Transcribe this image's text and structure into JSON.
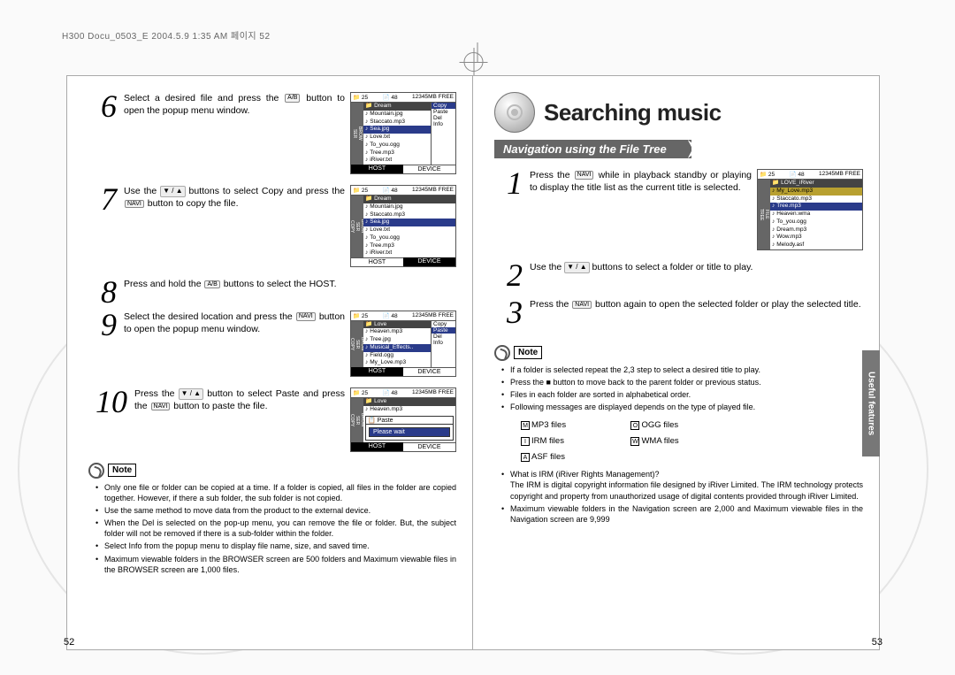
{
  "header": "H300 Docu_0503_E  2004.5.9 1:35 AM  페이지 52",
  "left_page": {
    "steps": [
      {
        "n": "6",
        "text_a": "Select a desired file and press the ",
        "btn": "A/B",
        "text_b": " button to open the popup menu window."
      },
      {
        "n": "7",
        "text_a": "Use the ",
        "arrows": "▼ / ▲",
        "text_b": " buttons to select Copy and press the ",
        "btn": "NAVI",
        "text_c": " button to copy the file."
      },
      {
        "n": "8",
        "text_a": "Press and hold the ",
        "btn": "A/B",
        "text_b": " buttons to select the HOST."
      },
      {
        "n": "9",
        "text_a": "Select the desired location and press the ",
        "btn": "NAVI",
        "text_b": " button to open the popup menu window."
      },
      {
        "n": "10",
        "text_a": "Press the ",
        "arrows": "▼ / ▲",
        "text_b": " button to select Paste and press the ",
        "btn": "NAVI",
        "text_c": " button to paste the file."
      }
    ],
    "shot_top": {
      "a": "📁 25",
      "b": "📄 48",
      "c": "12345MB FREE"
    },
    "shot1": {
      "header": "Dream",
      "rows": [
        "Mountain.jpg",
        "Staccato.mp3",
        "Sea.jpg",
        "Love.txt",
        "To_you.ogg",
        "Tree.mp3",
        "iRiver.txt"
      ],
      "sel_idx": 2,
      "menu": [
        "Copy",
        "Paste",
        "Del",
        "Info"
      ],
      "menu_sel": 0
    },
    "shot2": {
      "header": "Dream",
      "rows": [
        "Mountain.jpg",
        "Staccato.mp3",
        "Sea.jpg",
        "Love.txt",
        "To_you.ogg",
        "Tree.mp3",
        "iRiver.txt"
      ],
      "sel_idx": 2
    },
    "shot3": {
      "header": "Love",
      "rows": [
        "Heaven.mp3",
        "Tree.jpg",
        "Musical_Effects..",
        "Field.ogg",
        "My_Love.mp3"
      ],
      "sel_idx": 2,
      "menu": [
        "Copy",
        "Paste",
        "Del",
        "Info"
      ],
      "menu_sel": 1
    },
    "shot4": {
      "header": "Love",
      "rows": [
        "Heaven.mp3"
      ],
      "paste_t": "Paste",
      "paste_msg": "Please wait"
    },
    "note_label": "Note",
    "notes": [
      "Only one file or folder can be copied at a time. If a folder is copied, all files in the folder are copied together. However, if there a sub folder, the sub folder is not copied.",
      "Use the same method to move data from the product to the external device.",
      "When the Del is selected on the pop-up menu, you can remove the file or folder. But, the subject folder will not be removed if there is a sub-folder within the folder.",
      "Select Info from the popup menu to display file name, size, and saved time.",
      "Maximum viewable folders in the BROWSER screen are 500 folders and Maximum viewable files in the BROWSER screen are 1,000 files."
    ],
    "pageno": "52"
  },
  "right_page": {
    "title": "Searching music",
    "section": "Navigation using the File Tree",
    "side_tab": "Useful features",
    "steps": [
      {
        "n": "1",
        "text_a": "Press the ",
        "btn": "NAVI",
        "text_b": " while in playback standby or playing to display the title list as the current title is selected."
      },
      {
        "n": "2",
        "text_a": "Use the ",
        "arrows": "▼ / ▲",
        "text_b": " buttons to select a folder or title to play."
      },
      {
        "n": "3",
        "text_a": "Press the ",
        "btn": "NAVI",
        "text_b": " button again to open the selected folder or play the selected title."
      }
    ],
    "shot": {
      "top": {
        "a": "📁 25",
        "b": "📄 48",
        "c": "12345MB FREE"
      },
      "hdr1": "LOVE_iRiver",
      "hdr2": "My_Love.mp3",
      "rows": [
        "Staccato.mp3",
        "Tree.mp3",
        "Heaven.wma",
        "To_you.ogg",
        "Dream.mp3",
        "Wow.mp3",
        "Melody.asf"
      ],
      "sel_idx": 1
    },
    "note_label": "Note",
    "notes_a": [
      "If a folder is selected repeat the 2,3 step to select a desired title to play.",
      "Press the  ■  button to move back to the parent folder or previous status.",
      "Files in each folder are sorted in alphabetical order.",
      "Following messages are displayed depends on the type of played file."
    ],
    "ftypes": {
      "m": "MP3 files",
      "o": "OGG files",
      "i": "IRM  files",
      "w": "WMA files",
      "a": "ASF files"
    },
    "notes_b": [
      "What is IRM (iRiver Rights Management)?\nThe IRM is digital copyright information file designed by iRiver Limited. The IRM technology protects copyright and property from unauthorized usage of digital contents provided through iRiver Limited.",
      "Maximum viewable folders in the Navigation screen are 2,000 and Maximum viewable files in the Navigation screen are 9,999"
    ],
    "pageno": "53"
  }
}
